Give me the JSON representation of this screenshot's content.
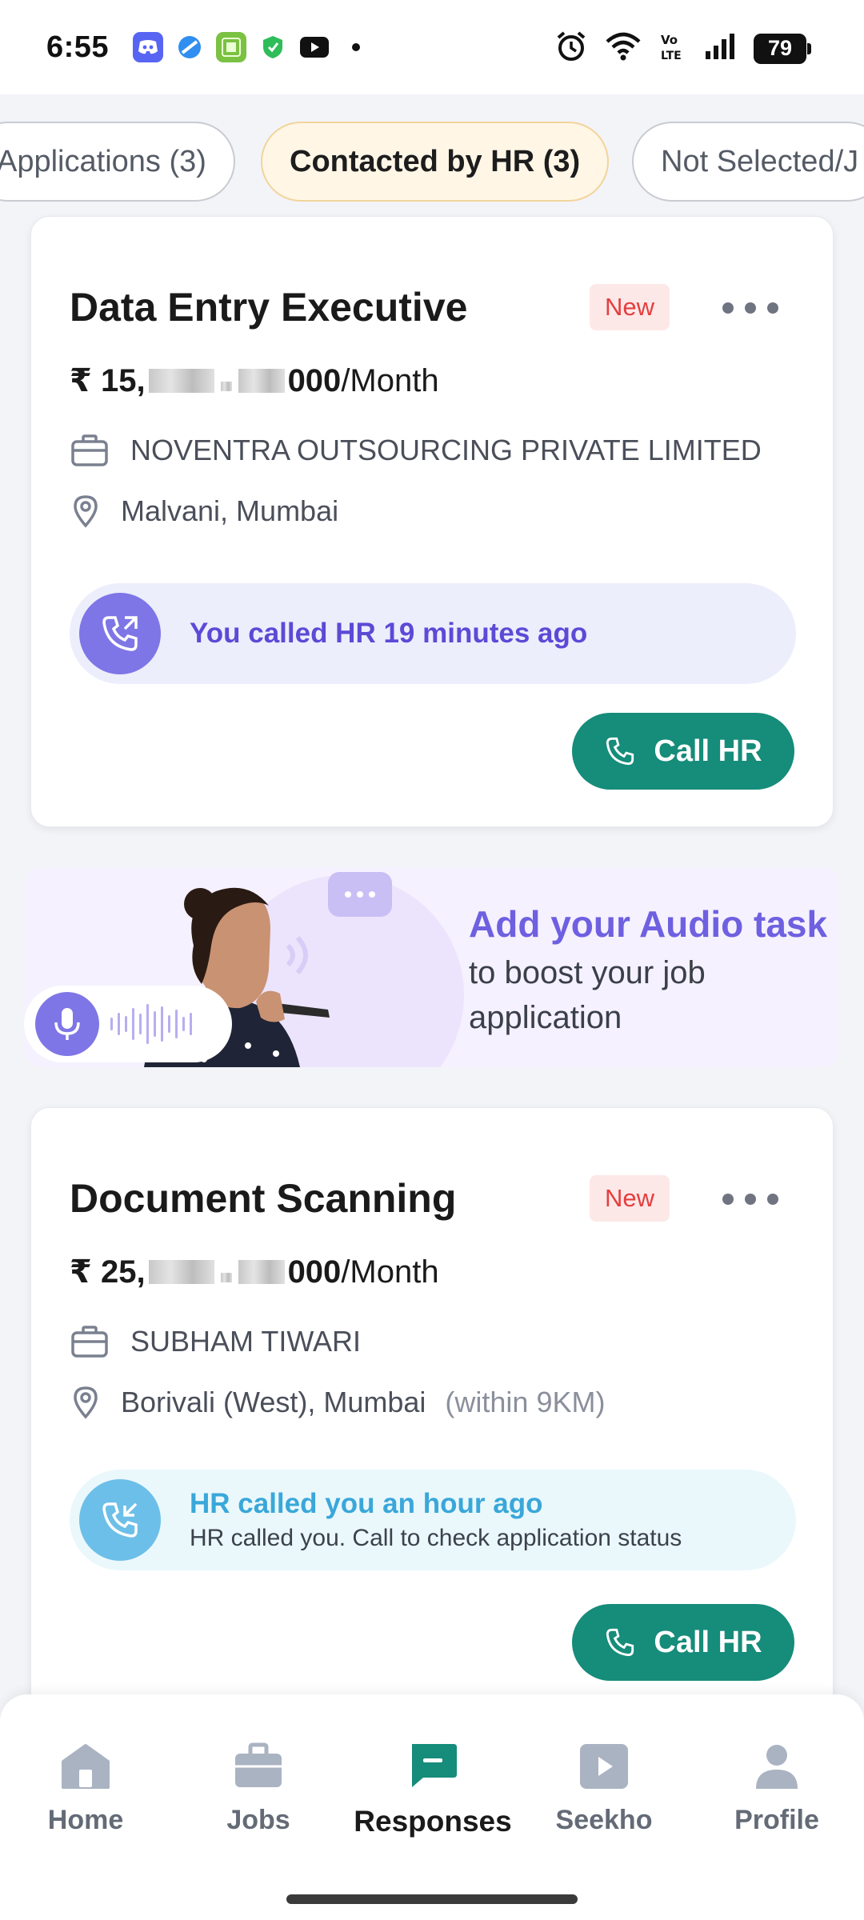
{
  "status_bar": {
    "time": "6:55",
    "battery": "79",
    "left_icons": [
      "discord-icon",
      "browser-icon",
      "app-icon-360",
      "shield-icon",
      "youtube-icon",
      "dot-icon"
    ],
    "right_icons": [
      "alarm-icon",
      "wifi-icon",
      "volte-icon",
      "signal-icon",
      "battery-icon"
    ]
  },
  "tabs": [
    {
      "label": "Applications (3)",
      "active": false
    },
    {
      "label": "Contacted by HR (3)",
      "active": true
    },
    {
      "label": "Not Selected/J",
      "active": false
    }
  ],
  "jobs": [
    {
      "title": "Data Entry Executive",
      "badge": "New",
      "salary_prefix": "₹ 15,",
      "salary_suffix": "000",
      "salary_period": " /Month",
      "company": "NOVENTRA OUTSOURCING PRIVATE LIMITED",
      "location": "Malvani, Mumbai",
      "distance": "",
      "call_status_title": "You called HR 19 minutes ago",
      "call_status_sub": "",
      "call_button": "Call HR"
    },
    {
      "title": "Document Scanning",
      "badge": "New",
      "salary_prefix": "₹ 25,",
      "salary_suffix": "000",
      "salary_period": " /Month",
      "company": "SUBHAM TIWARI",
      "location": "Borivali (West), Mumbai",
      "distance": "(within 9KM)",
      "call_status_title": "HR called you an hour ago",
      "call_status_sub": "HR called you. Call to check application status",
      "call_button": "Call HR"
    }
  ],
  "promo": {
    "title": "Add your Audio task",
    "subtitle": "to boost your job application"
  },
  "bottom_nav": [
    {
      "label": "Home",
      "icon": "home-icon",
      "active": false
    },
    {
      "label": "Jobs",
      "icon": "briefcase-icon",
      "active": false
    },
    {
      "label": "Responses",
      "icon": "chat-icon",
      "active": true
    },
    {
      "label": "Seekho",
      "icon": "play-icon",
      "active": false
    },
    {
      "label": "Profile",
      "icon": "person-icon",
      "active": false
    }
  ],
  "colors": {
    "accent_green": "#168c7a",
    "accent_purple": "#6e60e0",
    "badge_red": "#e53e3e",
    "tab_active_bg": "#fff6e6"
  }
}
